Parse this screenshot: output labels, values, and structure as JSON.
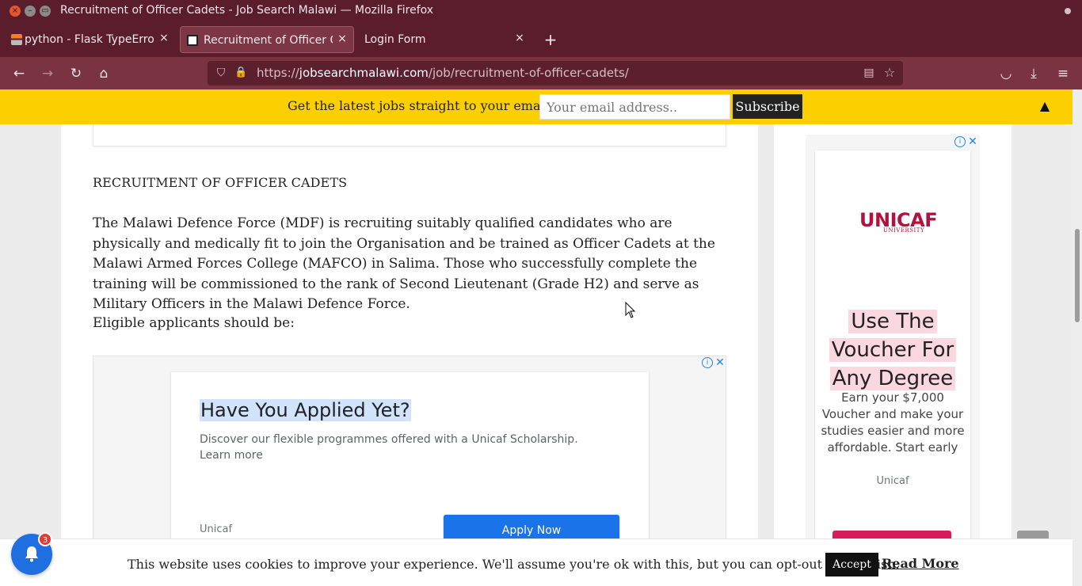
{
  "window": {
    "title": "Recruitment of Officer Cadets - Job Search Malawi — Mozilla Firefox",
    "close_glyph": "×",
    "min_glyph": "–",
    "max_glyph": "▭"
  },
  "tabs": [
    {
      "label": "python - Flask TypeError: ",
      "icon": "stackoverflow-icon",
      "close": "×"
    },
    {
      "label": "Recruitment of Officer Ca",
      "icon": "jobsearchmalawi-icon",
      "close": "×",
      "active": true
    },
    {
      "label": "Login Form",
      "icon": "",
      "close": "×"
    }
  ],
  "new_tab_glyph": "+",
  "nav": {
    "back_glyph": "←",
    "forward_glyph": "→",
    "reload_glyph": "↻",
    "home_glyph": "⌂",
    "url_prefix": "https://",
    "url_host": "jobsearchmalawi.com",
    "url_path": "/job/recruitment-of-officer-cadets/",
    "shield_glyph": "⛉",
    "lock_glyph": "🔒",
    "reader_glyph": "▤",
    "star_glyph": "☆",
    "pocket_glyph": "◡",
    "download_glyph": "⤓",
    "menu_glyph": "≡"
  },
  "subscribe_bar": {
    "label": "Get the latest jobs straight to your email",
    "placeholder": "Your email address..",
    "button": "Subscribe",
    "toggle_glyph": "▲"
  },
  "article": {
    "heading": "RECRUITMENT OF OFFICER CADETS",
    "paragraph": "The Malawi Defence Force (MDF) is recruiting suitably qualified candidates who are physically and medically fit to join the Organisation and be trained as Officer Cadets at the Malawi Armed Forces College (MAFCO) in Salima. Those who successfully complete the training will be commissioned to the rank of Second Lieutenant (Grade H2) and serve as Military Officers in the Malawi Defence Force.",
    "eligible": "Eligible applicants should be:"
  },
  "ad_content": {
    "info_glyph": "i",
    "close_glyph": "✕",
    "headline": "Have You Applied Yet?",
    "description": "Discover our flexible programmes offered with a Unicaf Scholarship. Learn more",
    "advertiser": "Unicaf",
    "cta": "Apply Now"
  },
  "ad_sidebar": {
    "info_glyph": "i",
    "close_glyph": "✕",
    "logo_main": "UNICAF",
    "logo_sub": "UNIVERSITY",
    "headline_lines": [
      "Use The",
      "Voucher For",
      "Any Degree"
    ],
    "body": "Earn your $7,000 Voucher and make your studies easier and more affordable. Start early",
    "advertiser": "Unicaf"
  },
  "cookie": {
    "text": "This website uses cookies to improve your experience. We'll assume you're ok with this, but you can opt-out if you wish.",
    "accept": "Accept",
    "read_more": "Read More"
  },
  "notifications": {
    "badge_count": "3"
  },
  "colors": {
    "firefox_chrome": "#5b1d2b",
    "navbar": "#7a3343",
    "subscribe_bar": "#fcd000",
    "ad_cta_blue": "#1a73e8",
    "unicaf_red": "#b3123f",
    "bell_blue": "#1f6fe0"
  }
}
